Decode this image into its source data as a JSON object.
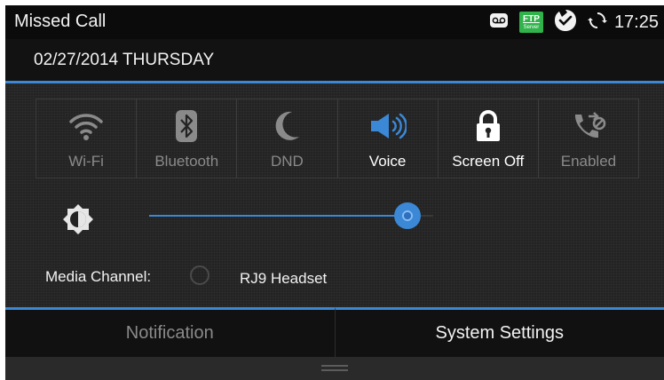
{
  "status_bar": {
    "title": "Missed Call",
    "ftp_badge": {
      "main": "FTP",
      "sub": "Server"
    },
    "time": "17:25",
    "icons": [
      "voicemail-icon",
      "ftp-server-icon",
      "check-badge-icon",
      "sync-icon"
    ]
  },
  "date_bar": {
    "text": "02/27/2014 THURSDAY"
  },
  "toggles": [
    {
      "label": "Wi-Fi",
      "icon": "wifi-icon",
      "active": false
    },
    {
      "label": "Bluetooth",
      "icon": "bluetooth-icon",
      "active": false
    },
    {
      "label": "DND",
      "icon": "moon-icon",
      "active": false
    },
    {
      "label": "Voice",
      "icon": "speaker-icon",
      "active": true
    },
    {
      "label": "Screen Off",
      "icon": "lock-icon",
      "active": true
    },
    {
      "label": "Enabled",
      "icon": "call-forward-icon",
      "active": false
    }
  ],
  "brightness": {
    "icon": "brightness-icon",
    "level": 0.91
  },
  "media_channel": {
    "label": "Media Channel:",
    "value": "RJ9 Headset"
  },
  "tabs": [
    {
      "label": "Notification",
      "selected": false
    },
    {
      "label": "System Settings",
      "selected": true
    }
  ],
  "colors": {
    "accent": "#3b88d6",
    "ftp_green": "#2fb34a",
    "text_active": "#ffffff",
    "text_inactive": "#8a8a8a"
  }
}
